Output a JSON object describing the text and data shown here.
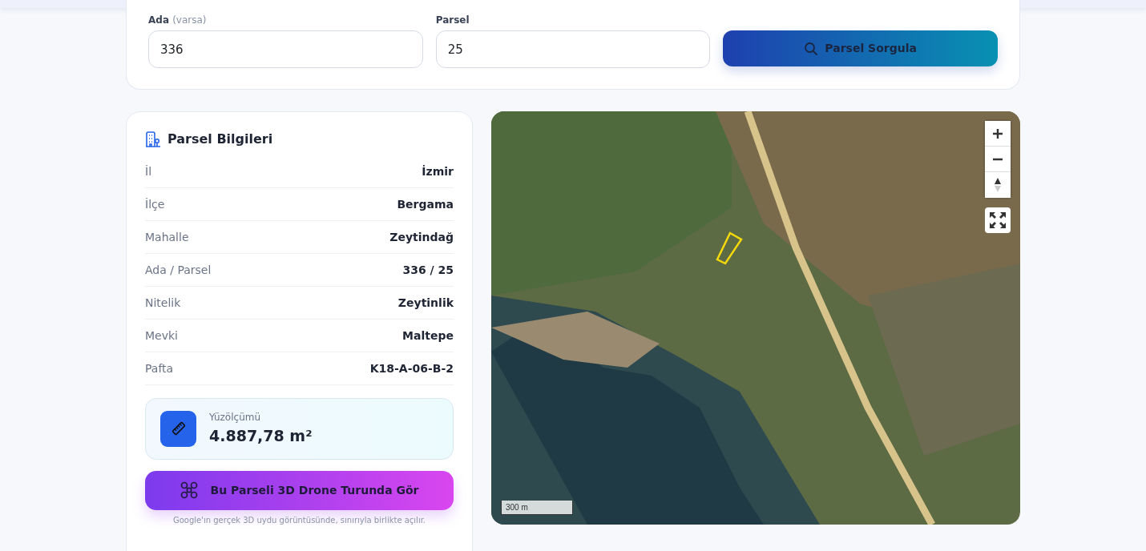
{
  "query_form": {
    "fields": [
      {
        "label": "Ada",
        "hint": "(varsa)",
        "value": "336"
      },
      {
        "label": "Parsel",
        "value": "25"
      }
    ],
    "button": "Parsel Sorgula"
  },
  "parcel_info": {
    "title": "Parsel Bilgileri",
    "rows": [
      {
        "label": "İl",
        "value": "İzmir"
      },
      {
        "label": "İlçe",
        "value": "Bergama"
      },
      {
        "label": "Mahalle",
        "value": "Zeytindağ"
      },
      {
        "label": "Ada / Parsel",
        "value": "336 / 25"
      },
      {
        "label": "Nitelik",
        "value": "Zeytinlik"
      },
      {
        "label": "Mevki",
        "value": "Maltepe"
      },
      {
        "label": "Pafta",
        "value": "K18-A-06-B-2"
      }
    ],
    "area": {
      "label": "Yüzölçümü",
      "value": "4.887,78 m²"
    },
    "drone_button": "Bu Parseli 3D Drone Turunda Gör",
    "drone_note": "Google'ın gerçek 3D uydu görüntüsünde, sınırıyla birlikte açılır."
  },
  "map": {
    "scale": "300 m"
  }
}
